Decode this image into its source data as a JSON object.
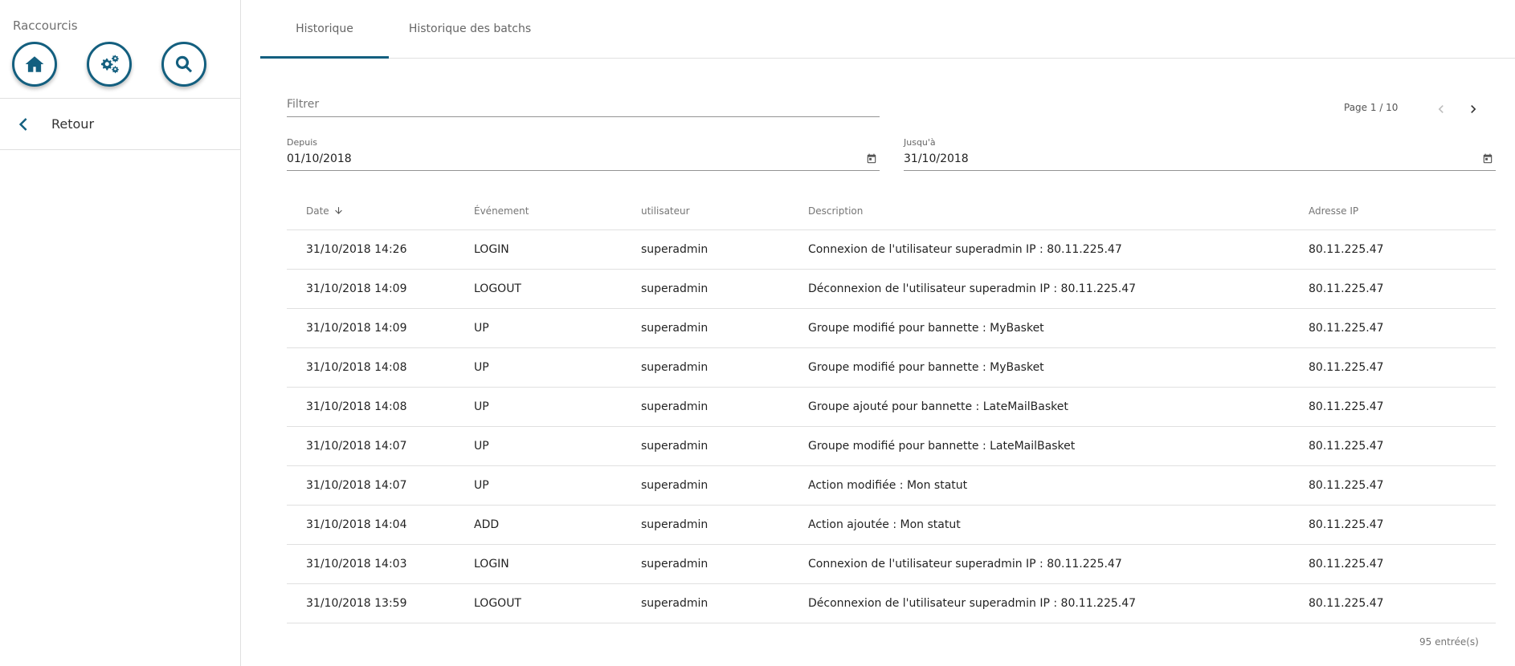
{
  "sidebar": {
    "shortcuts_title": "Raccourcis",
    "shortcuts": [
      {
        "icon": "home-icon"
      },
      {
        "icon": "admin-gears-icon"
      },
      {
        "icon": "search-icon"
      }
    ],
    "back_label": "Retour"
  },
  "tabs": [
    {
      "label": "Historique",
      "active": true
    },
    {
      "label": "Historique des batchs",
      "active": false
    }
  ],
  "filter": {
    "placeholder": "Filtrer",
    "value": ""
  },
  "pager": {
    "label": "Page 1 / 10"
  },
  "dates": {
    "since_label": "Depuis",
    "since_value": "01/10/2018",
    "until_label": "Jusqu'à",
    "until_value": "31/10/2018"
  },
  "table": {
    "headers": {
      "date": "Date",
      "event": "Événement",
      "user": "utilisateur",
      "description": "Description",
      "ip": "Adresse IP"
    },
    "rows": [
      {
        "date": "31/10/2018 14:26",
        "event": "LOGIN",
        "user": "superadmin",
        "description": "Connexion de l'utilisateur superadmin IP : 80.11.225.47",
        "ip": "80.11.225.47"
      },
      {
        "date": "31/10/2018 14:09",
        "event": "LOGOUT",
        "user": "superadmin",
        "description": "Déconnexion de l'utilisateur superadmin IP : 80.11.225.47",
        "ip": "80.11.225.47"
      },
      {
        "date": "31/10/2018 14:09",
        "event": "UP",
        "user": "superadmin",
        "description": "Groupe modifié pour bannette : MyBasket",
        "ip": "80.11.225.47"
      },
      {
        "date": "31/10/2018 14:08",
        "event": "UP",
        "user": "superadmin",
        "description": "Groupe modifié pour bannette : MyBasket",
        "ip": "80.11.225.47"
      },
      {
        "date": "31/10/2018 14:08",
        "event": "UP",
        "user": "superadmin",
        "description": "Groupe ajouté pour bannette : LateMailBasket",
        "ip": "80.11.225.47"
      },
      {
        "date": "31/10/2018 14:07",
        "event": "UP",
        "user": "superadmin",
        "description": "Groupe modifié pour bannette : LateMailBasket",
        "ip": "80.11.225.47"
      },
      {
        "date": "31/10/2018 14:07",
        "event": "UP",
        "user": "superadmin",
        "description": "Action modifiée : Mon statut",
        "ip": "80.11.225.47"
      },
      {
        "date": "31/10/2018 14:04",
        "event": "ADD",
        "user": "superadmin",
        "description": "Action ajoutée : Mon statut",
        "ip": "80.11.225.47"
      },
      {
        "date": "31/10/2018 14:03",
        "event": "LOGIN",
        "user": "superadmin",
        "description": "Connexion de l'utilisateur superadmin IP : 80.11.225.47",
        "ip": "80.11.225.47"
      },
      {
        "date": "31/10/2018 13:59",
        "event": "LOGOUT",
        "user": "superadmin",
        "description": "Déconnexion de l'utilisateur superadmin IP : 80.11.225.47",
        "ip": "80.11.225.47"
      }
    ],
    "entries_label": "95 entrée(s)"
  },
  "colors": {
    "accent": "#135f7f"
  }
}
